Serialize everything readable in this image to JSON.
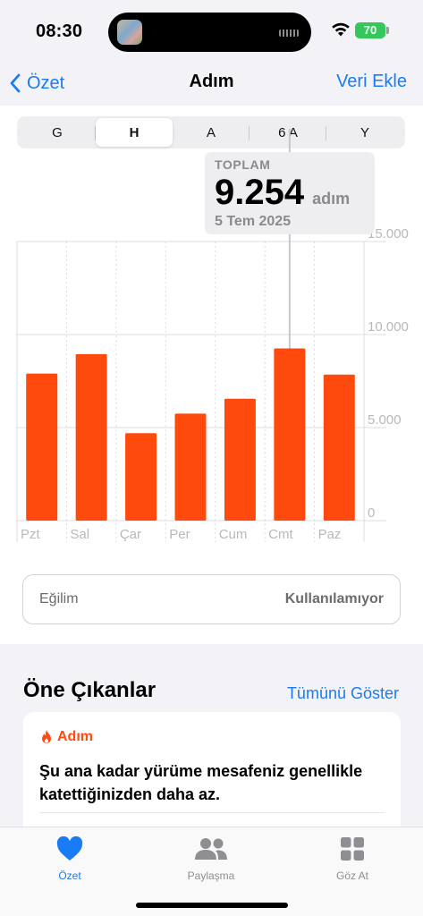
{
  "status": {
    "time": "08:30",
    "battery": "70"
  },
  "nav": {
    "back_label": "Özet",
    "title": "Adım",
    "action_label": "Veri Ekle"
  },
  "segments": [
    {
      "label": "G",
      "selected": false
    },
    {
      "label": "H",
      "selected": true
    },
    {
      "label": "A",
      "selected": false
    },
    {
      "label": "6 A",
      "selected": false
    },
    {
      "label": "Y",
      "selected": false
    }
  ],
  "callout": {
    "label": "TOPLAM",
    "value": "9.254",
    "unit": "adım",
    "date": "5 Tem 2025"
  },
  "chart_data": {
    "type": "bar",
    "categories": [
      "Pzt",
      "Sal",
      "Çar",
      "Per",
      "Cum",
      "Cmt",
      "Paz"
    ],
    "values": [
      7900,
      8950,
      4700,
      5750,
      6550,
      9254,
      7850
    ],
    "y_ticks": [
      {
        "value": 0,
        "label": "0"
      },
      {
        "value": 5000,
        "label": "5.000"
      },
      {
        "value": 10000,
        "label": "10.000"
      },
      {
        "value": 15000,
        "label": "15.000"
      }
    ],
    "ylim": [
      0,
      15000
    ],
    "selected_index": 5,
    "bar_color": "#ff4a0e"
  },
  "trend": {
    "label": "Eğilim",
    "value": "Kullanılamıyor"
  },
  "highlights": {
    "title": "Öne Çıkanlar",
    "show_all": "Tümünü Göster",
    "card": {
      "category": "Adım",
      "message": "Şu ana kadar yürüme mesafeniz genellikle katettiğinizden daha az."
    }
  },
  "tabs": [
    {
      "label": "Özet",
      "icon": "heart-icon",
      "active": true
    },
    {
      "label": "Paylaşma",
      "icon": "people-icon",
      "active": false
    },
    {
      "label": "Göz At",
      "icon": "grid-icon",
      "active": false
    }
  ],
  "colors": {
    "accent": "#1a7cf5",
    "steps": "#ff4a0e",
    "battery": "#34c759"
  }
}
